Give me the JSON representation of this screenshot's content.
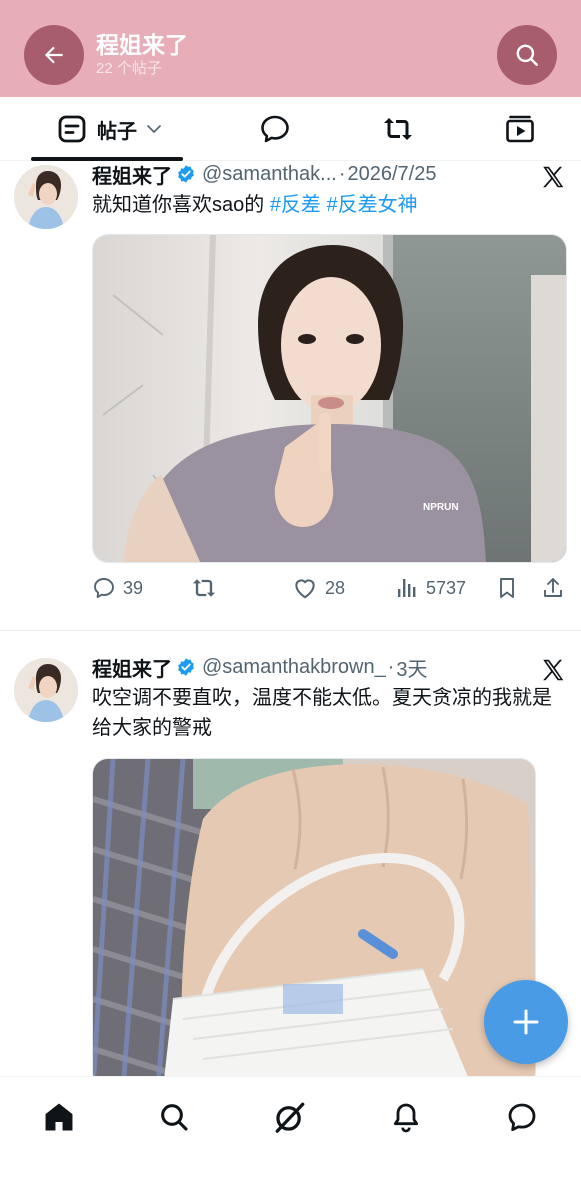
{
  "header": {
    "title": "程姐来了",
    "subtitle": "22 个帖子",
    "back_icon": "arrow-left-icon",
    "search_icon": "search-icon",
    "bg_color": "#e8aeb7",
    "button_color": "#a85d6c"
  },
  "tabs": [
    {
      "label": "帖子",
      "icon": "posts-icon",
      "selected": true
    },
    {
      "label": "",
      "icon": "replies-icon",
      "selected": false
    },
    {
      "label": "",
      "icon": "repost-icon",
      "selected": false
    },
    {
      "label": "",
      "icon": "media-icon",
      "selected": false
    }
  ],
  "posts": [
    {
      "name": "程姐来了",
      "handle": "@samanthak...",
      "separator": "·",
      "time": "2026/7/25",
      "text": "就知道你喜欢sao的 ",
      "hashtags": [
        "#反差",
        "#反差女神"
      ],
      "media": "woman-selfie-photo",
      "stats": {
        "replies": "39",
        "reposts": "",
        "likes": "28",
        "views": "5737"
      }
    },
    {
      "name": "程姐来了",
      "handle": "@samanthakbrown_",
      "separator": "·",
      "time": "3天",
      "text": "吹空调不要直吹，温度不能太低。夏天贪凉的我就是给大家的警戒",
      "media": "hand-iv-photo"
    }
  ],
  "colors": {
    "accent": "#1d9bf0",
    "fab": "#4a9be6",
    "muted_text": "#536471",
    "verified": "#1d9bf0"
  },
  "fab": {
    "icon": "plus-icon"
  },
  "bottom_nav": [
    "home-icon",
    "search-icon",
    "grok-icon",
    "bell-icon",
    "message-icon"
  ]
}
